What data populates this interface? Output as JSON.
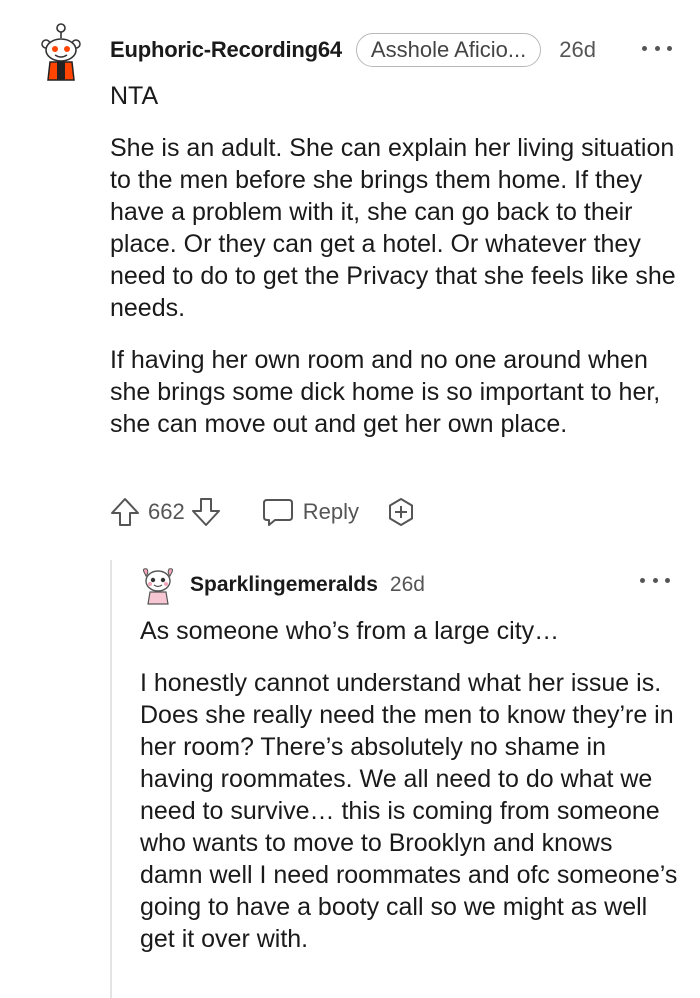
{
  "comment": {
    "username": "Euphoric-Recording64",
    "flair": "Asshole Aficio...",
    "age": "26d",
    "paragraphs": [
      "NTA",
      "She is an adult. She can explain her living situation to the men before she brings them home. If they have a problem with it, she can go back to their place. Or they can get a hotel. Or whatever they need to do to get the Privacy that she feels like she needs.",
      "If having her own room and no one around when she brings some dick home is so important to her, she can move out and get her own place."
    ],
    "score": "662",
    "reply_label": "Reply",
    "icons": [
      "upvote-icon",
      "downvote-icon",
      "reply-icon",
      "award-icon",
      "more-icon"
    ]
  },
  "reply": {
    "username": "Sparklingemeralds",
    "age": "26d",
    "paragraphs": [
      "As someone who’s from a large city…",
      "I honestly cannot understand what her issue is. Does she really need the men to know they’re in her room? There’s absolutely no shame in having roommates. We all need to do what we need to survive… this is coming from someone who wants to move to Brooklyn and knows damn well I need roommates and ofc someone’s going to have a booty call so we might as well get it over with."
    ]
  },
  "colors": {
    "text": "#1a1a1b",
    "meta": "#555555",
    "accent": "#ff4500",
    "thread": "#e4e4e4"
  }
}
